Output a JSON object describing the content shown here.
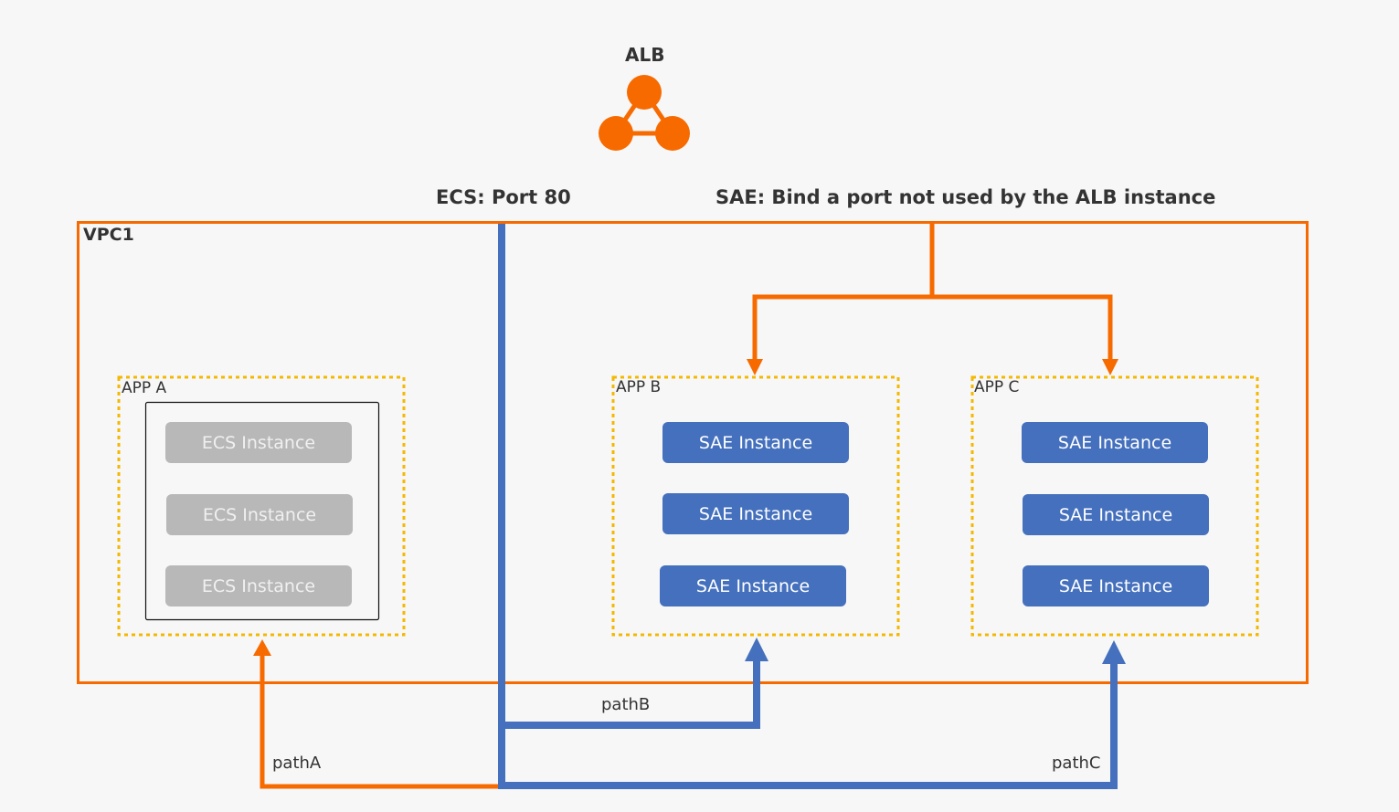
{
  "colors": {
    "background": "#f7f7f7",
    "orange": "#f76a00",
    "blue": "#4470bd",
    "app_border_dotted": "#f5b800",
    "ecs_instance": "#b8b8b8",
    "sae_instance": "#4470bd",
    "text": "#333333"
  },
  "alb": {
    "title": "ALB",
    "icon": "alb-load-balancer-icon"
  },
  "annotations": {
    "ecs_port": "ECS: Port 80",
    "sae_port": "SAE: Bind a port not used by the ALB instance"
  },
  "vpc": {
    "label": "VPC1"
  },
  "apps": [
    {
      "label": "APP A",
      "instance_type": "ecs",
      "instances": [
        "ECS Instance",
        "ECS Instance",
        "ECS Instance"
      ]
    },
    {
      "label": "APP B",
      "instance_type": "sae",
      "instances": [
        "SAE Instance",
        "SAE Instance",
        "SAE Instance"
      ]
    },
    {
      "label": "APP C",
      "instance_type": "sae",
      "instances": [
        "SAE Instance",
        "SAE Instance",
        "SAE Instance"
      ]
    }
  ],
  "paths": {
    "pathA": "pathA",
    "pathB": "pathB",
    "pathC": "pathC"
  }
}
